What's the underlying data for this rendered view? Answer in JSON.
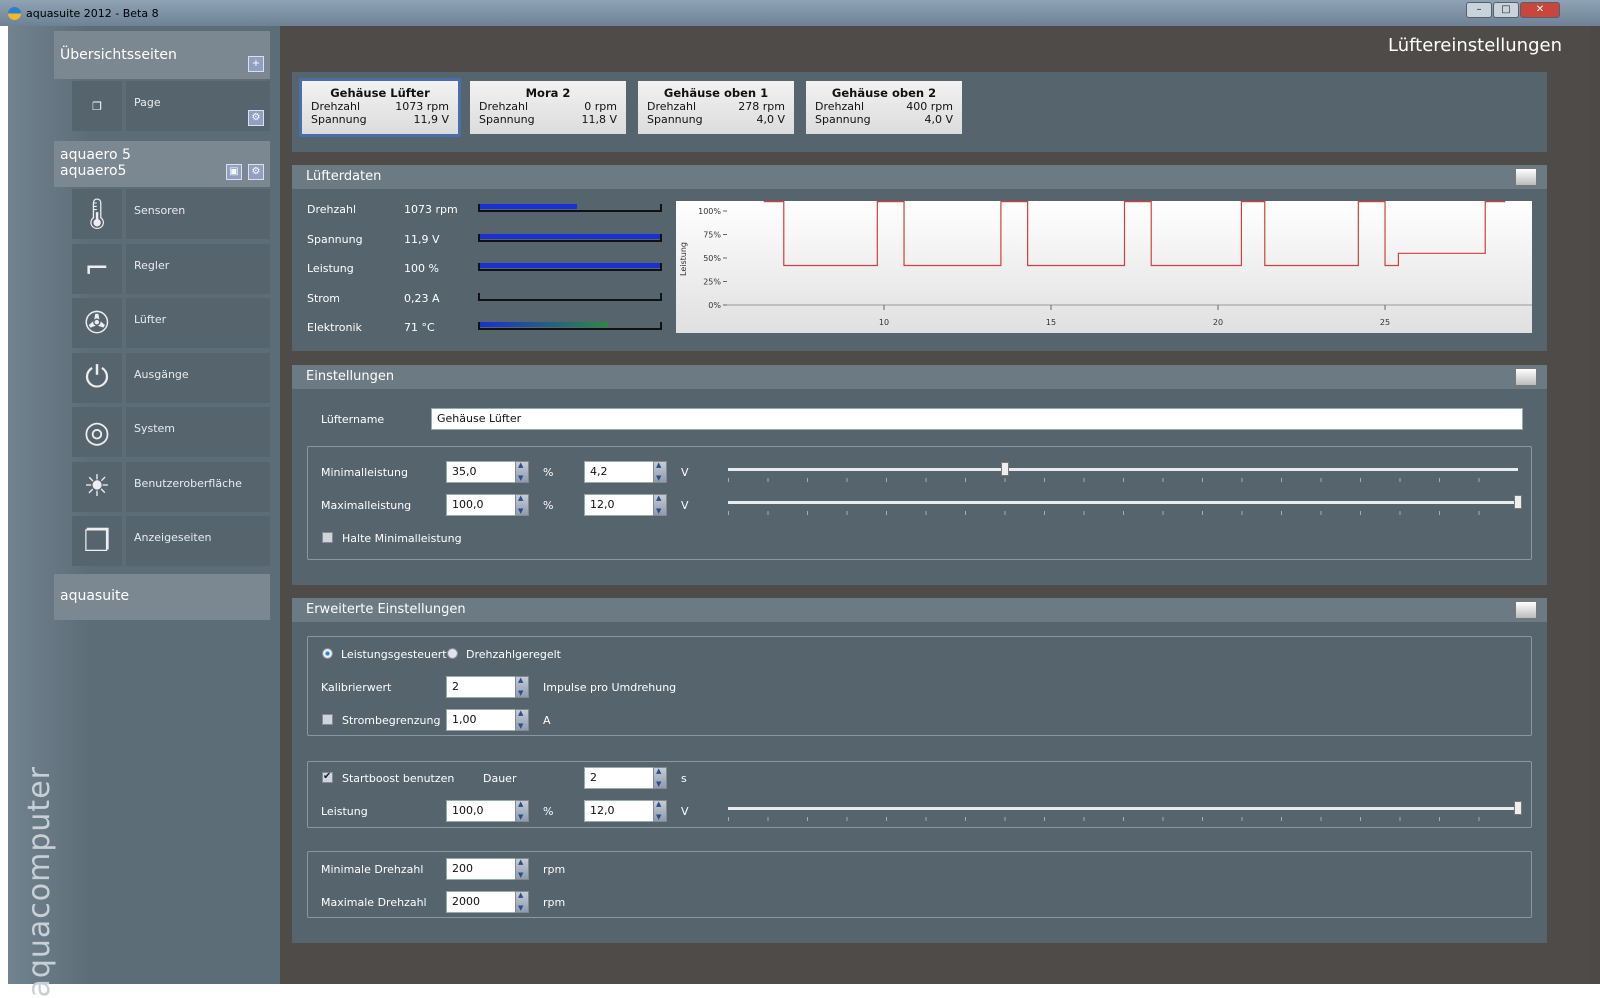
{
  "window": {
    "title": "aquasuite 2012 - Beta 8",
    "controls": [
      "–",
      "□",
      "✕"
    ]
  },
  "sidebar": {
    "overview": {
      "title": "Übersichtsseiten",
      "page": "Page"
    },
    "device": {
      "line1": "aquaero 5",
      "line2": "aquaero5"
    },
    "items": [
      {
        "label": "Sensoren",
        "icon": "thermometer-icon",
        "glyph": "🌡"
      },
      {
        "label": "Regler",
        "icon": "controller-stairs-icon",
        "glyph": "⌐"
      },
      {
        "label": "Lüfter",
        "icon": "fan-icon",
        "glyph": "✇"
      },
      {
        "label": "Ausgänge",
        "icon": "plug-icon",
        "glyph": "⏻"
      },
      {
        "label": "System",
        "icon": "system-gears-icon",
        "glyph": "◎"
      },
      {
        "label": "Benutzeroberfläche",
        "icon": "brightness-icon",
        "glyph": "☀"
      },
      {
        "label": "Anzeigeseiten",
        "icon": "pages-icon",
        "glyph": "❐"
      }
    ],
    "footer": "aquasuite",
    "brand": "aquacomputer"
  },
  "header": {
    "title": "Lüftereinstellungen"
  },
  "fans": [
    {
      "name": "Gehäuse Lüfter",
      "rpm_label": "Drehzahl",
      "rpm": "1073 rpm",
      "volt_label": "Spannung",
      "volt": "11,9 V",
      "selected": true
    },
    {
      "name": "Mora 2",
      "rpm_label": "Drehzahl",
      "rpm": "0 rpm",
      "volt_label": "Spannung",
      "volt": "11,8 V"
    },
    {
      "name": "Gehäuse oben 1",
      "rpm_label": "Drehzahl",
      "rpm": "278 rpm",
      "volt_label": "Spannung",
      "volt": "4,0 V"
    },
    {
      "name": "Gehäuse oben 2",
      "rpm_label": "Drehzahl",
      "rpm": "400 rpm",
      "volt_label": "Spannung",
      "volt": "4,0 V"
    }
  ],
  "fandata": {
    "title": "Lüfterdaten",
    "rows": [
      {
        "label": "Drehzahl",
        "value": "1073 rpm",
        "fill": 54
      },
      {
        "label": "Spannung",
        "value": "11,9 V",
        "fill": 100
      },
      {
        "label": "Leistung",
        "value": "100 %",
        "fill": 100
      },
      {
        "label": "Strom",
        "value": "0,23 A",
        "fill": 0
      },
      {
        "label": "Elektronik",
        "value": "71 °C",
        "fill": 71
      }
    ]
  },
  "chart_data": {
    "type": "line",
    "ylabel": "Leistung",
    "yticks": [
      "0%",
      "25%",
      "50%",
      "75%",
      "100%"
    ],
    "xticks": [
      10,
      15,
      20,
      25
    ],
    "xlim": [
      5.3,
      29.4
    ],
    "ylim": [
      0,
      110
    ],
    "color": "#d04040",
    "x": [
      6.4,
      7.0,
      7.0,
      9.8,
      9.8,
      10.6,
      10.6,
      13.5,
      13.5,
      14.3,
      14.3,
      17.2,
      17.2,
      18.0,
      18.0,
      20.7,
      20.7,
      21.4,
      21.4,
      24.2,
      24.2,
      25.0,
      25.0,
      25.4,
      25.4,
      28.0,
      28.0,
      28.6
    ],
    "y": [
      110,
      110,
      42,
      42,
      110,
      110,
      42,
      42,
      110,
      110,
      42,
      42,
      110,
      110,
      42,
      42,
      110,
      110,
      42,
      42,
      110,
      110,
      42,
      42,
      55,
      55,
      110,
      110
    ]
  },
  "settings": {
    "title": "Einstellungen",
    "name_label": "Lüftername",
    "name_value": "Gehäuse Lüfter",
    "min_label": "Minimalleistung",
    "min_pct": "35,0",
    "min_volt": "4,2",
    "min_slider": 35,
    "max_label": "Maximalleistung",
    "max_pct": "100,0",
    "max_volt": "12,0",
    "max_slider": 100,
    "pct_unit": "%",
    "volt_unit": "V",
    "hold_label": "Halte Minimalleistung",
    "hold_checked": false
  },
  "advanced": {
    "title": "Erweiterte Einstellungen",
    "mode_power": "Leistungsgesteuert",
    "mode_rpm": "Drehzahlgeregelt",
    "mode_selected": "power",
    "calib_label": "Kalibrierwert",
    "calib_value": "2",
    "calib_unit": "Impulse pro Umdrehung",
    "current_label": "Strombegrenzung",
    "current_value": "1,00",
    "current_unit": "A",
    "current_checked": false,
    "boost_label": "Startboost benutzen",
    "boost_checked": true,
    "duration_label": "Dauer",
    "duration_value": "2",
    "duration_unit": "s",
    "boost_power_label": "Leistung",
    "boost_pct": "100,0",
    "boost_volt": "12,0",
    "boost_slider": 100,
    "pct_unit": "%",
    "volt_unit": "V",
    "min_rpm_label": "Minimale Drehzahl",
    "min_rpm": "200",
    "max_rpm_label": "Maximale Drehzahl",
    "max_rpm": "2000",
    "rpm_unit": "rpm"
  }
}
